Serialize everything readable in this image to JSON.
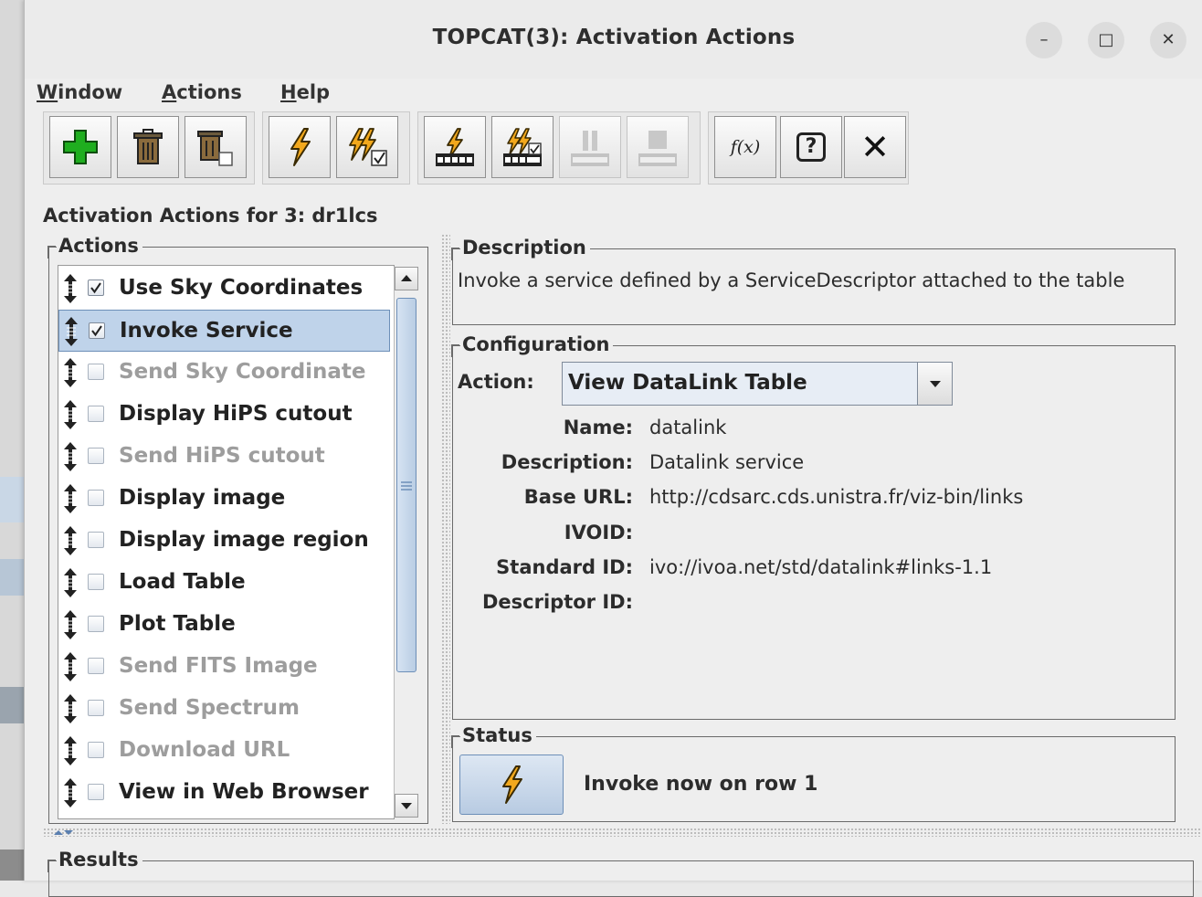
{
  "window": {
    "title": "TOPCAT(3): Activation Actions",
    "controls": {
      "minimize": "–",
      "maximize": "□",
      "close": "✕"
    }
  },
  "menubar": [
    {
      "label": "Window",
      "mnemonic": "W",
      "rest": "indow"
    },
    {
      "label": "Actions",
      "mnemonic": "A",
      "rest": "ctions"
    },
    {
      "label": "Help",
      "mnemonic": "H",
      "rest": "elp"
    }
  ],
  "toolbar": {
    "buttons": [
      {
        "name": "add-action-button",
        "icon": "green-plus-icon",
        "enabled": true
      },
      {
        "name": "delete-action-button",
        "icon": "trash-icon",
        "enabled": true
      },
      {
        "name": "delete-all-button",
        "icon": "trash-all-icon",
        "enabled": true
      },
      {
        "name": "invoke-button",
        "icon": "lightning-icon",
        "enabled": true
      },
      {
        "name": "invoke-all-button",
        "icon": "lightning-multi-check-icon",
        "enabled": true
      },
      {
        "name": "invoke-rows-button",
        "icon": "lightning-film-icon",
        "enabled": true
      },
      {
        "name": "invoke-rows-all-button",
        "icon": "lightning-film-multi-icon",
        "enabled": true
      },
      {
        "name": "pause-button",
        "icon": "pause-icon",
        "enabled": false
      },
      {
        "name": "stop-button",
        "icon": "stop-icon",
        "enabled": false
      },
      {
        "name": "function-button",
        "icon": "fx-icon",
        "label": "f(x)",
        "enabled": true
      },
      {
        "name": "help-button",
        "icon": "help-bubble-icon",
        "label": "?",
        "enabled": true
      },
      {
        "name": "close-button",
        "icon": "close-x-icon",
        "label": "✕",
        "enabled": true
      }
    ]
  },
  "heading": "Activation Actions for 3: dr1lcs",
  "actions_panel": {
    "title": "Actions",
    "items": [
      {
        "label": "Use Sky Coordinates",
        "checked": true,
        "enabled": true,
        "selected": false
      },
      {
        "label": "Invoke Service",
        "checked": true,
        "enabled": true,
        "selected": true
      },
      {
        "label": "Send Sky Coordinate",
        "checked": false,
        "enabled": false,
        "selected": false
      },
      {
        "label": "Display HiPS cutout",
        "checked": false,
        "enabled": true,
        "selected": false
      },
      {
        "label": "Send HiPS cutout",
        "checked": false,
        "enabled": false,
        "selected": false
      },
      {
        "label": "Display image",
        "checked": false,
        "enabled": true,
        "selected": false
      },
      {
        "label": "Display image region",
        "checked": false,
        "enabled": true,
        "selected": false
      },
      {
        "label": "Load Table",
        "checked": false,
        "enabled": true,
        "selected": false
      },
      {
        "label": "Plot Table",
        "checked": false,
        "enabled": true,
        "selected": false
      },
      {
        "label": "Send FITS Image",
        "checked": false,
        "enabled": false,
        "selected": false
      },
      {
        "label": "Send Spectrum",
        "checked": false,
        "enabled": false,
        "selected": false
      },
      {
        "label": "Download URL",
        "checked": false,
        "enabled": false,
        "selected": false
      },
      {
        "label": "View in Web Browser",
        "checked": false,
        "enabled": true,
        "selected": false
      }
    ]
  },
  "description_panel": {
    "title": "Description",
    "text": "Invoke a service defined by a ServiceDescriptor attached to the table"
  },
  "configuration_panel": {
    "title": "Configuration",
    "action_label": "Action:",
    "action_value": "View DataLink Table",
    "fields": [
      {
        "label": "Name:",
        "value": "datalink"
      },
      {
        "label": "Description:",
        "value": "Datalink service"
      },
      {
        "label": "Base URL:",
        "value": "http://cdsarc.cds.unistra.fr/viz-bin/links"
      },
      {
        "label": "IVOID:",
        "value": ""
      },
      {
        "label": "Standard ID:",
        "value": "ivo://ivoa.net/std/datalink#links-1.1"
      },
      {
        "label": "Descriptor ID:",
        "value": ""
      }
    ]
  },
  "status_panel": {
    "title": "Status",
    "button_icon": "lightning-icon",
    "text": "Invoke now on row 1"
  },
  "results_panel": {
    "title": "Results"
  },
  "colors": {
    "selection": "#bfd3ea",
    "lightning": "#f2a81d",
    "plus": "#1fae1f"
  }
}
